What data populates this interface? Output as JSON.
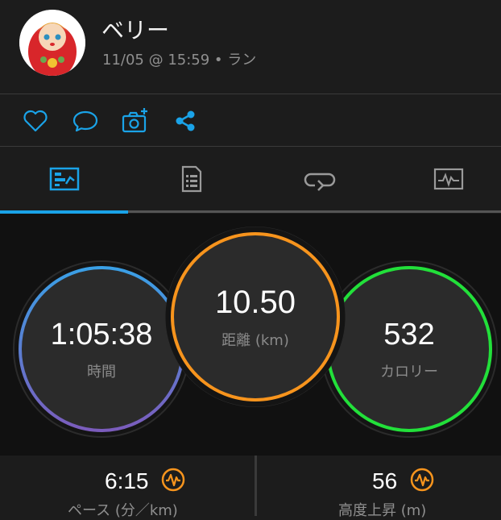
{
  "header": {
    "user_name": "ベリー",
    "meta": "11/05 @ 15:59 • ラン"
  },
  "actions": [
    {
      "icon": "heart-icon"
    },
    {
      "icon": "comment-icon"
    },
    {
      "icon": "camera-add-icon"
    },
    {
      "icon": "share-icon"
    }
  ],
  "tabs": [
    {
      "icon": "summary-icon",
      "active": true
    },
    {
      "icon": "details-icon",
      "active": false
    },
    {
      "icon": "laps-icon",
      "active": false
    },
    {
      "icon": "graph-icon",
      "active": false
    }
  ],
  "stats": {
    "time": {
      "value": "1:05:38",
      "label": "時間"
    },
    "distance": {
      "value": "10.50",
      "label": "距離 (km)"
    },
    "calories": {
      "value": "532",
      "label": "カロリー"
    }
  },
  "bottom": {
    "pace": {
      "value": "6:15",
      "label": "ペース (分／km)",
      "icon": "activity-icon"
    },
    "elevation": {
      "value": "56",
      "label": "高度上昇 (m)",
      "icon": "activity-icon"
    }
  },
  "colors": {
    "accent": "#1aa3e8",
    "distance_ring": "#f7941d",
    "calories_ring": "#22e03a",
    "time_ring_start": "#3aa0e6",
    "time_ring_end": "#7b5cbc",
    "chart_icon": "#f7941d"
  }
}
